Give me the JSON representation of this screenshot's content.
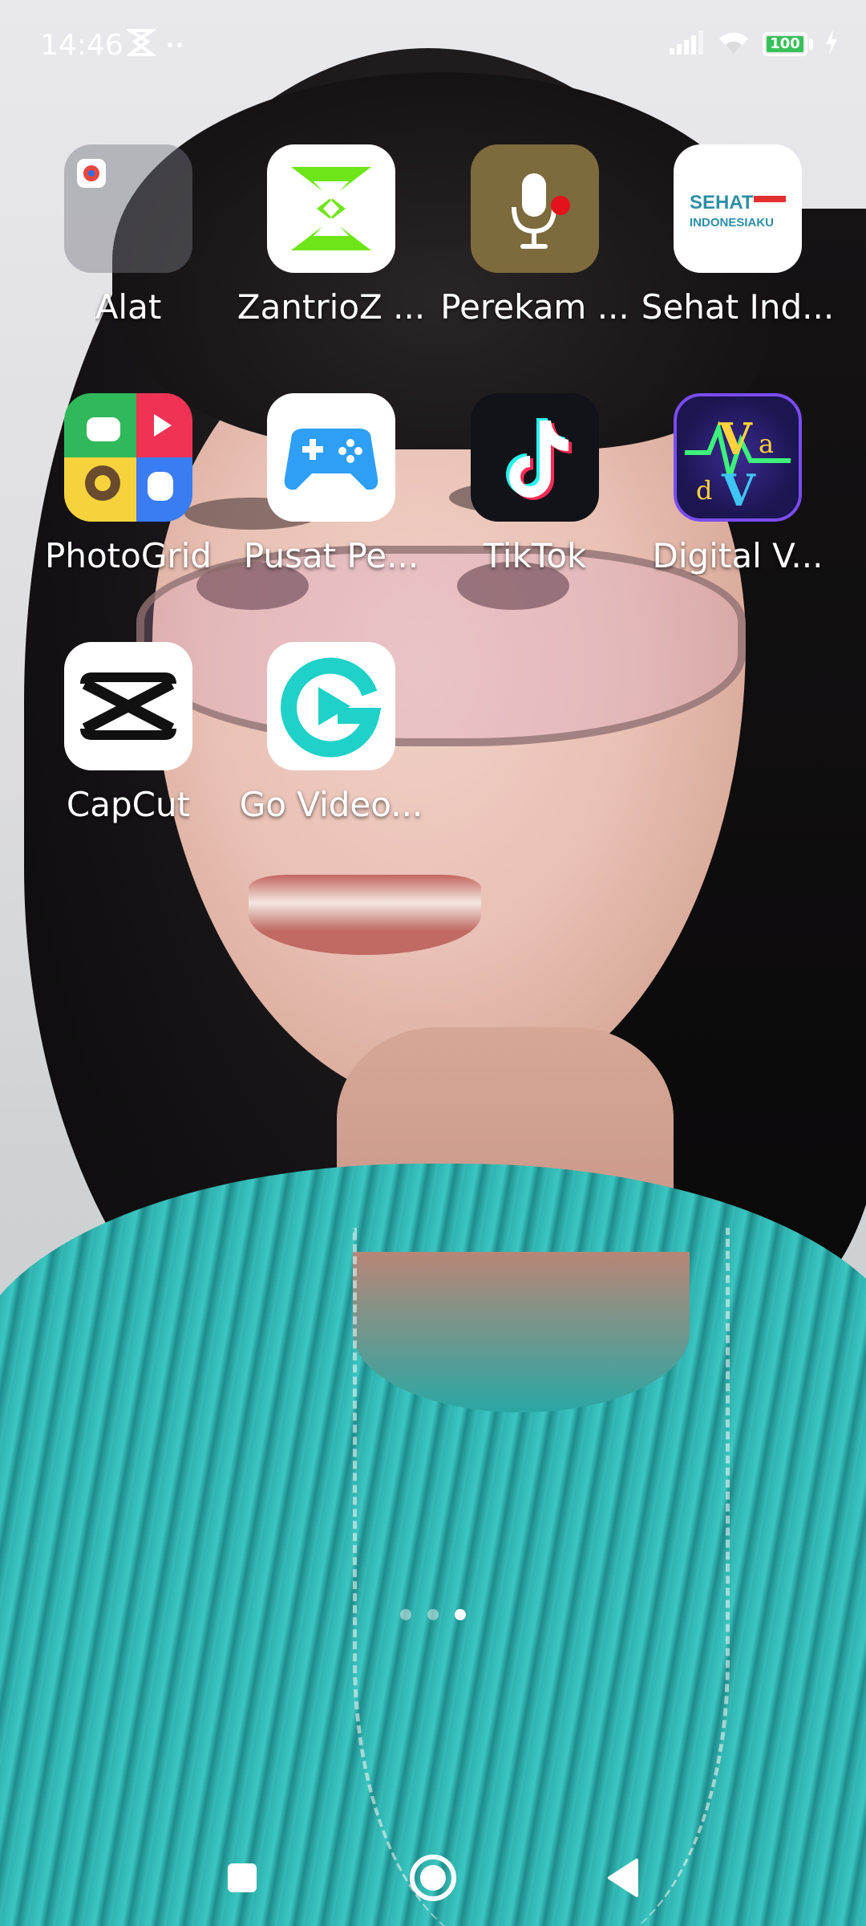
{
  "status_bar": {
    "time": "14:46",
    "left_icons": [
      "zantrioz-notification-icon",
      "more-notifications-icon"
    ],
    "right_icons": [
      "signal-icon",
      "wifi-icon",
      "battery-icon",
      "charging-icon"
    ],
    "battery_level": "100",
    "battery_color": "#37c15a"
  },
  "apps": [
    {
      "label": "Alat",
      "icon": "folder-icon"
    },
    {
      "label": "ZantrioZ ...",
      "icon": "zantrioz-icon"
    },
    {
      "label": "Perekam ...",
      "icon": "voice-recorder-icon"
    },
    {
      "label": "Sehat Ind...",
      "icon": "sehat-indonesiaku-icon"
    },
    {
      "label": "PhotoGrid",
      "icon": "photogrid-icon"
    },
    {
      "label": "Pusat Pe...",
      "icon": "game-center-icon"
    },
    {
      "label": "TikTok",
      "icon": "tiktok-icon"
    },
    {
      "label": "Digital V...",
      "icon": "digital-v-icon"
    },
    {
      "label": "CapCut",
      "icon": "capcut-icon"
    },
    {
      "label": "Go Video...",
      "icon": "go-video-icon"
    }
  ],
  "icon_text": {
    "sehat_line1": "SEHAT",
    "sehat_line2": "INDONESIAKU",
    "digital_v_letters": [
      "V",
      "a",
      "d",
      "V"
    ]
  },
  "page_indicator": {
    "count": 3,
    "active": 2
  },
  "nav_bar": {
    "buttons": [
      "recents-button",
      "home-button",
      "back-button"
    ]
  }
}
